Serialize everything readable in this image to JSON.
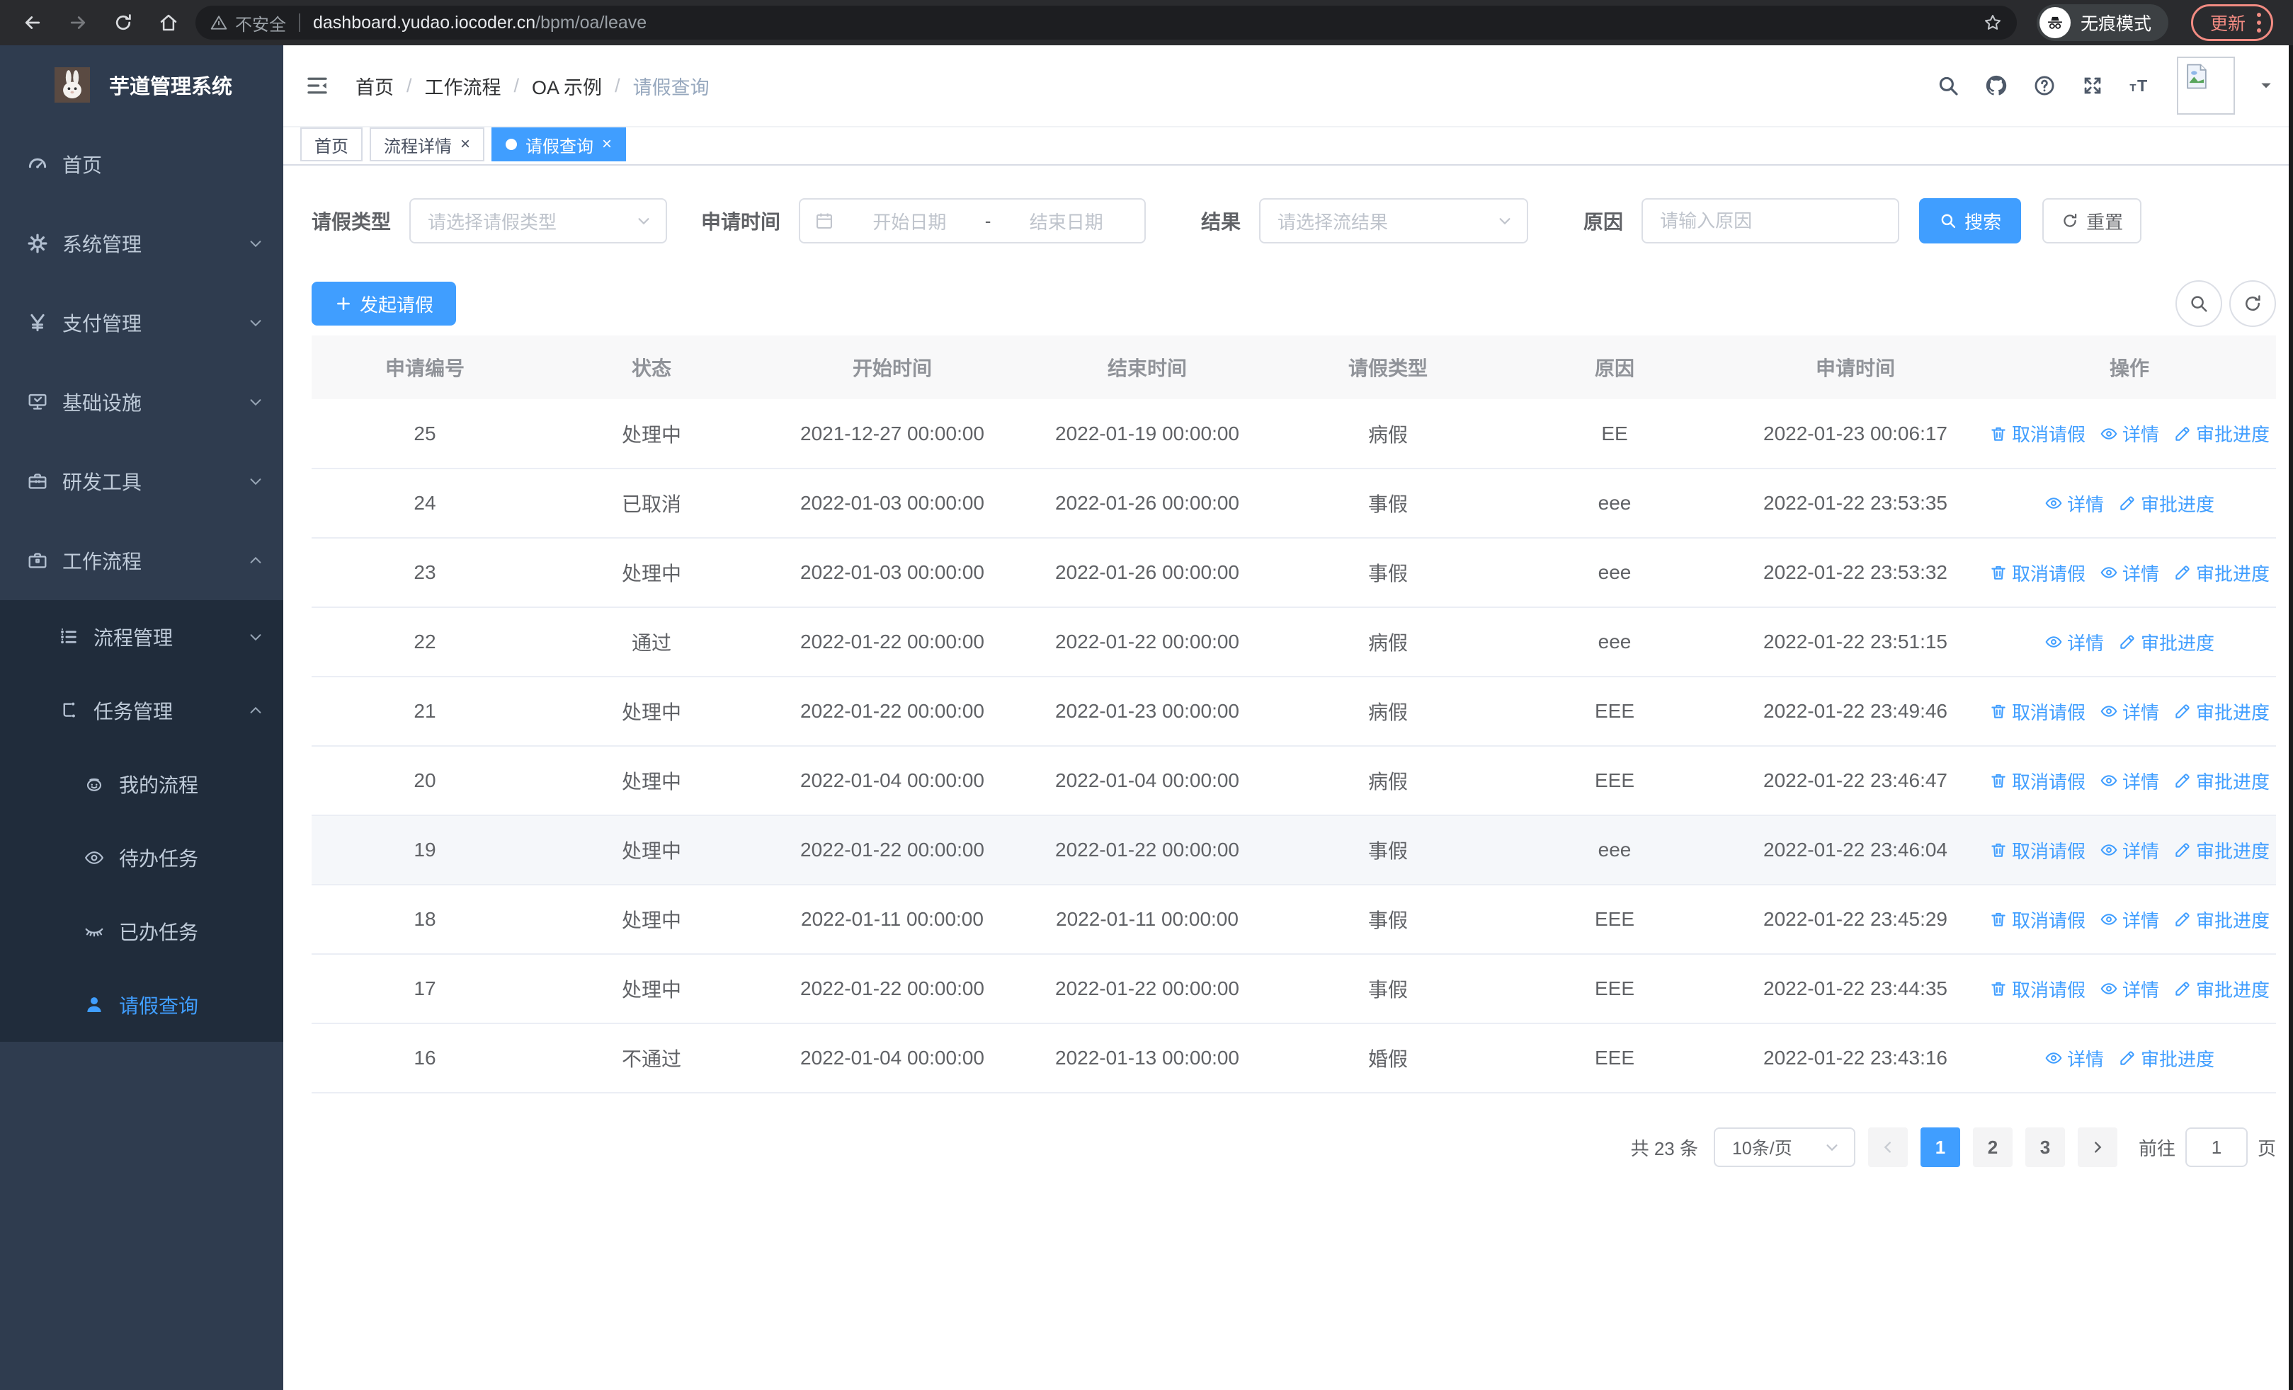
{
  "browser": {
    "security_label": "不安全",
    "url_host": "dashboard.yudao.iocoder.cn",
    "url_path": "/bpm/oa/leave",
    "incognito_label": "无痕模式",
    "update_label": "更新"
  },
  "sidebar": {
    "title": "芋道管理系统",
    "menu": [
      {
        "label": "首页",
        "icon": "gauge-icon",
        "level": 1,
        "chevron": "",
        "submenu": false,
        "active": false
      },
      {
        "label": "系统管理",
        "icon": "gear-icon",
        "level": 1,
        "chevron": "down",
        "submenu": false,
        "active": false
      },
      {
        "label": "支付管理",
        "icon": "yen-icon",
        "level": 1,
        "chevron": "down",
        "submenu": false,
        "active": false
      },
      {
        "label": "基础设施",
        "icon": "monitor-icon",
        "level": 1,
        "chevron": "down",
        "submenu": false,
        "active": false
      },
      {
        "label": "研发工具",
        "icon": "toolbox-icon",
        "level": 1,
        "chevron": "down",
        "submenu": false,
        "active": false
      },
      {
        "label": "工作流程",
        "icon": "briefcase-icon",
        "level": 1,
        "chevron": "up",
        "submenu": false,
        "active": false
      },
      {
        "label": "流程管理",
        "icon": "list-icon",
        "level": 2,
        "chevron": "down",
        "submenu": true,
        "active": false
      },
      {
        "label": "任务管理",
        "icon": "tree-icon",
        "level": 2,
        "chevron": "up",
        "submenu": true,
        "active": false
      },
      {
        "label": "我的流程",
        "icon": "robot-icon",
        "level": 3,
        "chevron": "",
        "submenu": true,
        "active": false
      },
      {
        "label": "待办任务",
        "icon": "eye-icon",
        "level": 3,
        "chevron": "",
        "submenu": true,
        "active": false
      },
      {
        "label": "已办任务",
        "icon": "eye-closed-icon",
        "level": 3,
        "chevron": "",
        "submenu": true,
        "active": false
      },
      {
        "label": "请假查询",
        "icon": "person-icon",
        "level": 3,
        "chevron": "",
        "submenu": true,
        "active": true
      }
    ]
  },
  "header": {
    "breadcrumb": [
      "首页",
      "工作流程",
      "OA 示例",
      "请假查询"
    ]
  },
  "tabs": [
    {
      "label": "首页",
      "closable": false,
      "active": false
    },
    {
      "label": "流程详情",
      "closable": true,
      "active": false
    },
    {
      "label": "请假查询",
      "closable": true,
      "active": true
    }
  ],
  "filters": {
    "leave_type_label": "请假类型",
    "leave_type_placeholder": "请选择请假类型",
    "apply_time_label": "申请时间",
    "start_date_placeholder": "开始日期",
    "range_separator": "-",
    "end_date_placeholder": "结束日期",
    "result_label": "结果",
    "result_placeholder": "请选择流结果",
    "reason_label": "原因",
    "reason_placeholder": "请输入原因",
    "search_label": "搜索",
    "reset_label": "重置"
  },
  "toolbar": {
    "create_label": "发起请假"
  },
  "table": {
    "columns": [
      "申请编号",
      "状态",
      "开始时间",
      "结束时间",
      "请假类型",
      "原因",
      "申请时间",
      "操作"
    ],
    "rows": [
      {
        "id": "25",
        "status": "处理中",
        "start": "2021-12-27 00:00:00",
        "end": "2022-01-19 00:00:00",
        "type": "病假",
        "reason": "EE",
        "apply_time": "2022-01-23 00:06:17",
        "highlight": false,
        "actions": [
          {
            "label": "取消请假",
            "icon": "trash-icon"
          },
          {
            "label": "详情",
            "icon": "detail-eye-icon"
          },
          {
            "label": "审批进度",
            "icon": "pen-icon"
          }
        ]
      },
      {
        "id": "24",
        "status": "已取消",
        "start": "2022-01-03 00:00:00",
        "end": "2022-01-26 00:00:00",
        "type": "事假",
        "reason": "eee",
        "apply_time": "2022-01-22 23:53:35",
        "highlight": false,
        "actions": [
          {
            "label": "详情",
            "icon": "detail-eye-icon"
          },
          {
            "label": "审批进度",
            "icon": "pen-icon"
          }
        ]
      },
      {
        "id": "23",
        "status": "处理中",
        "start": "2022-01-03 00:00:00",
        "end": "2022-01-26 00:00:00",
        "type": "事假",
        "reason": "eee",
        "apply_time": "2022-01-22 23:53:32",
        "highlight": false,
        "actions": [
          {
            "label": "取消请假",
            "icon": "trash-icon"
          },
          {
            "label": "详情",
            "icon": "detail-eye-icon"
          },
          {
            "label": "审批进度",
            "icon": "pen-icon"
          }
        ]
      },
      {
        "id": "22",
        "status": "通过",
        "start": "2022-01-22 00:00:00",
        "end": "2022-01-22 00:00:00",
        "type": "病假",
        "reason": "eee",
        "apply_time": "2022-01-22 23:51:15",
        "highlight": false,
        "actions": [
          {
            "label": "详情",
            "icon": "detail-eye-icon"
          },
          {
            "label": "审批进度",
            "icon": "pen-icon"
          }
        ]
      },
      {
        "id": "21",
        "status": "处理中",
        "start": "2022-01-22 00:00:00",
        "end": "2022-01-23 00:00:00",
        "type": "病假",
        "reason": "EEE",
        "apply_time": "2022-01-22 23:49:46",
        "highlight": false,
        "actions": [
          {
            "label": "取消请假",
            "icon": "trash-icon"
          },
          {
            "label": "详情",
            "icon": "detail-eye-icon"
          },
          {
            "label": "审批进度",
            "icon": "pen-icon"
          }
        ]
      },
      {
        "id": "20",
        "status": "处理中",
        "start": "2022-01-04 00:00:00",
        "end": "2022-01-04 00:00:00",
        "type": "病假",
        "reason": "EEE",
        "apply_time": "2022-01-22 23:46:47",
        "highlight": false,
        "actions": [
          {
            "label": "取消请假",
            "icon": "trash-icon"
          },
          {
            "label": "详情",
            "icon": "detail-eye-icon"
          },
          {
            "label": "审批进度",
            "icon": "pen-icon"
          }
        ]
      },
      {
        "id": "19",
        "status": "处理中",
        "start": "2022-01-22 00:00:00",
        "end": "2022-01-22 00:00:00",
        "type": "事假",
        "reason": "eee",
        "apply_time": "2022-01-22 23:46:04",
        "highlight": true,
        "actions": [
          {
            "label": "取消请假",
            "icon": "trash-icon"
          },
          {
            "label": "详情",
            "icon": "detail-eye-icon"
          },
          {
            "label": "审批进度",
            "icon": "pen-icon"
          }
        ]
      },
      {
        "id": "18",
        "status": "处理中",
        "start": "2022-01-11 00:00:00",
        "end": "2022-01-11 00:00:00",
        "type": "事假",
        "reason": "EEE",
        "apply_time": "2022-01-22 23:45:29",
        "highlight": false,
        "actions": [
          {
            "label": "取消请假",
            "icon": "trash-icon"
          },
          {
            "label": "详情",
            "icon": "detail-eye-icon"
          },
          {
            "label": "审批进度",
            "icon": "pen-icon"
          }
        ]
      },
      {
        "id": "17",
        "status": "处理中",
        "start": "2022-01-22 00:00:00",
        "end": "2022-01-22 00:00:00",
        "type": "事假",
        "reason": "EEE",
        "apply_time": "2022-01-22 23:44:35",
        "highlight": false,
        "actions": [
          {
            "label": "取消请假",
            "icon": "trash-icon"
          },
          {
            "label": "详情",
            "icon": "detail-eye-icon"
          },
          {
            "label": "审批进度",
            "icon": "pen-icon"
          }
        ]
      },
      {
        "id": "16",
        "status": "不通过",
        "start": "2022-01-04 00:00:00",
        "end": "2022-01-13 00:00:00",
        "type": "婚假",
        "reason": "EEE",
        "apply_time": "2022-01-22 23:43:16",
        "highlight": false,
        "actions": [
          {
            "label": "详情",
            "icon": "detail-eye-icon"
          },
          {
            "label": "审批进度",
            "icon": "pen-icon"
          }
        ]
      }
    ]
  },
  "pagination": {
    "total_label": "共 23 条",
    "page_size_label": "10条/页",
    "pages": [
      "1",
      "2",
      "3"
    ],
    "active_page": "1",
    "goto_label": "前往",
    "goto_value": "1",
    "goto_suffix": "页"
  }
}
